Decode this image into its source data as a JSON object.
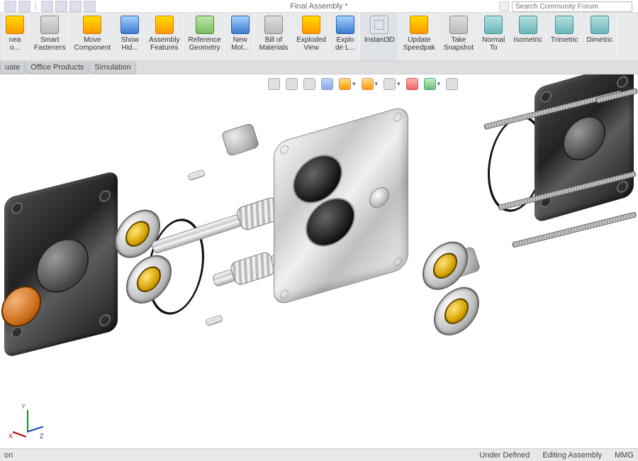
{
  "title": "Final Assembly *",
  "search": {
    "placeholder": "Search Community Forum"
  },
  "ribbon": [
    {
      "label": "nea\no..."
    },
    {
      "label": "Smart\nFasteners"
    },
    {
      "label": "Move\nComponent"
    },
    {
      "label": "Show\nHid..."
    },
    {
      "label": "Assembly\nFeatures"
    },
    {
      "label": "Reference\nGeometry"
    },
    {
      "label": "New\nMot..."
    },
    {
      "label": "Bill of\nMaterials"
    },
    {
      "label": "Exploded\nView"
    },
    {
      "label": "Explo\nde L..."
    },
    {
      "label": "Instant3D"
    },
    {
      "label": "Update\nSpeedpak"
    },
    {
      "label": "Take\nSnapshot"
    },
    {
      "label": "Normal\nTo"
    },
    {
      "label": "Isometric"
    },
    {
      "label": "Trimetric"
    },
    {
      "label": "Dimetric"
    }
  ],
  "subtabs": [
    "uate",
    "Office Products",
    "Simulation"
  ],
  "status": {
    "left": "on",
    "right1": "Under Defined",
    "right2": "Editing Assembly",
    "right3": "MMG"
  }
}
